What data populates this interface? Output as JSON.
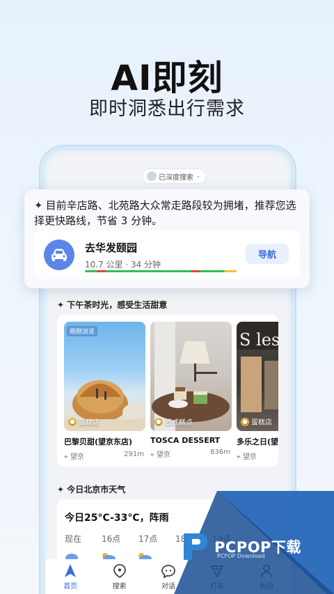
{
  "hero": {
    "title": "AI即刻",
    "subtitle": "即时洞悉出行需求"
  },
  "deep_search": {
    "label": "已深度搜索"
  },
  "ai_card": {
    "message": "目前辛店路、北苑路大众常走路段较为拥堵，推荐您选择更快路线，节省 3 分钟。",
    "route": {
      "destination": "去华发颐园",
      "distance_time": "10.7 公里 · 34 分钟",
      "nav_label": "导航"
    }
  },
  "tea_section": {
    "title": "下午茶时光，感受生活甜意",
    "shops": [
      {
        "badge": "刚刚浏览",
        "category": "蛋糕店",
        "name": "巴黎贝甜(望京东店)",
        "area": "望京",
        "distance": "291m"
      },
      {
        "badge": "",
        "category": "西式糕点",
        "name": "TOSCA DESSERT",
        "area": "望京",
        "distance": "836m"
      },
      {
        "badge": "",
        "category": "蛋糕店",
        "name": "多乐之日(望",
        "area": "望京",
        "distance": ""
      }
    ]
  },
  "weather": {
    "section_title": "今日北京市天气",
    "summary": "今日25°C-33°C，阵雨",
    "hours": [
      "现在",
      "16点",
      "17点",
      "18点",
      "19点"
    ]
  },
  "tabbar": {
    "items": [
      {
        "label": "首页",
        "icon": "navigate-arrow-icon",
        "active": true
      },
      {
        "label": "搜索",
        "icon": "location-pin-icon",
        "active": false
      },
      {
        "label": "对话",
        "icon": "chat-bubble-icon",
        "active": false
      },
      {
        "label": "打车",
        "icon": "taxi-icon",
        "active": false
      },
      {
        "label": "我的",
        "icon": "user-icon",
        "active": false
      }
    ]
  },
  "watermark": {
    "brand": "PCPOP下载",
    "sub": "PCPOP Download"
  },
  "colors": {
    "accent": "#3a6fd8",
    "car_circle": "#5b86e8",
    "watermark_blue": "#1f63b6"
  }
}
